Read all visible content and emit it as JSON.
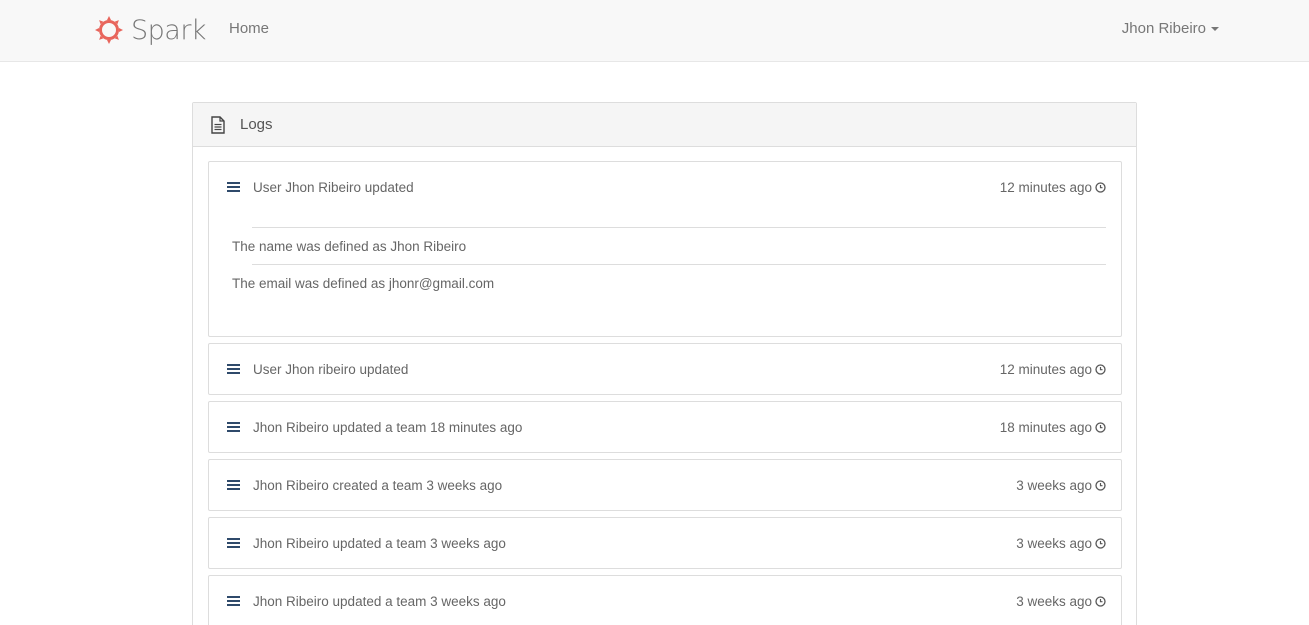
{
  "navbar": {
    "brand": "Spark",
    "home_label": "Home",
    "user_name": "Jhon Ribeiro"
  },
  "colors": {
    "brand_icon": "#e8655c",
    "list_icon": "#2f4a6b"
  },
  "panel": {
    "title": "Logs",
    "icon": "document-icon"
  },
  "logs": [
    {
      "title": "User Jhon Ribeiro updated",
      "time": "12 minutes ago",
      "details": [
        "The name was defined as Jhon Ribeiro",
        "The email was defined as jhonr@gmail.com"
      ]
    },
    {
      "title": "User Jhon ribeiro updated",
      "time": "12 minutes ago"
    },
    {
      "title": "Jhon Ribeiro updated a team 18 minutes ago",
      "time": "18 minutes ago"
    },
    {
      "title": "Jhon Ribeiro created a team 3 weeks ago",
      "time": "3 weeks ago"
    },
    {
      "title": "Jhon Ribeiro updated a team 3 weeks ago",
      "time": "3 weeks ago"
    },
    {
      "title": "Jhon Ribeiro updated a team 3 weeks ago",
      "time": "3 weeks ago"
    }
  ]
}
